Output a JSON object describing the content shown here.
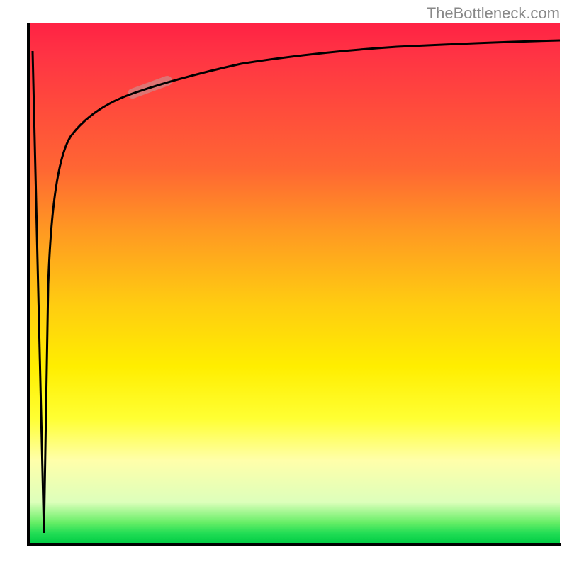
{
  "watermark": "TheBottleneck.com",
  "colors": {
    "gradient_top": "#ff2244",
    "gradient_mid1": "#ff9922",
    "gradient_mid2": "#ffee00",
    "gradient_bottom": "#00cc44",
    "axis": "#000000",
    "curve": "#000000",
    "highlight": "#d08888"
  },
  "chart_data": {
    "type": "line",
    "title": "",
    "xlabel": "",
    "ylabel": "",
    "xlim": [
      0,
      100
    ],
    "ylim": [
      0,
      100
    ],
    "x": [
      3,
      4,
      6,
      8,
      10,
      13,
      17,
      22,
      28,
      36,
      46,
      58,
      72,
      86,
      100
    ],
    "values": [
      2,
      50,
      70,
      78,
      82,
      85,
      87.5,
      89.5,
      91,
      92.2,
      93.2,
      94,
      94.7,
      95.2,
      95.6
    ],
    "annotations": [
      {
        "type": "highlight_segment",
        "x_range": [
          19,
          26
        ],
        "note": "marked pill region on curve"
      },
      {
        "type": "vertical_spike",
        "x": 4,
        "from_y": 2,
        "to_y": 50,
        "note": "steep initial drop/spike from bottom"
      }
    ],
    "grid": false,
    "legend": false,
    "background": "vertical_gradient_red_to_green"
  }
}
